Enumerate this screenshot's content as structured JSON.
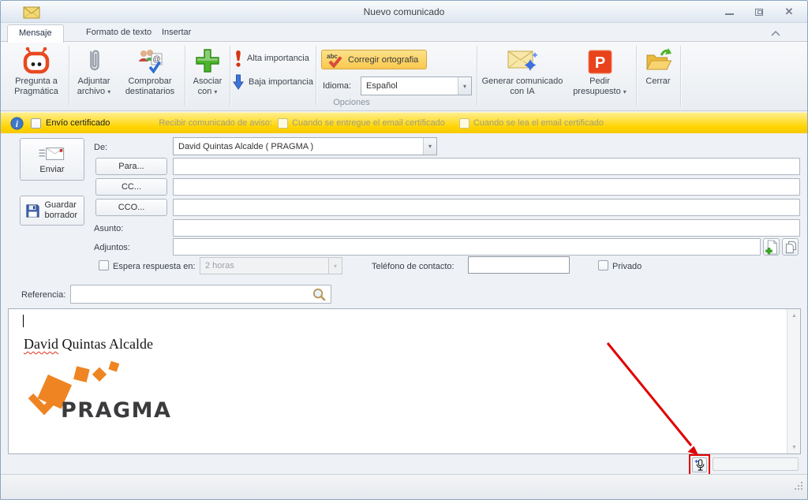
{
  "window": {
    "title": "Nuevo comunicado"
  },
  "glyphs": {
    "close": "✕",
    "dropdown": "▾",
    "scroll_up": "▲",
    "scroll_down": "▼"
  },
  "tabs": {
    "items": [
      {
        "label": "Mensaje",
        "active": true
      },
      {
        "label": "Formato de texto",
        "active": false
      },
      {
        "label": "Insertar",
        "active": false
      }
    ]
  },
  "ribbon": {
    "pregunta_label": "Pregunta a Pragmática",
    "adjuntar_label": "Adjuntar archivo",
    "comprobar_label": "Comprobar destinatarios",
    "asociar_label": "Asociar con",
    "alta_label": "Alta importancia",
    "baja_label": "Baja importancia",
    "corregir_label": "Corregir ortografia",
    "idioma_label": "Idioma:",
    "idioma_value": "Español",
    "group_opciones": "Opciones",
    "generar_label": "Generar comunicado con IA",
    "pedir_label": "Pedir presupuesto",
    "cerrar_label": "Cerrar"
  },
  "certbar": {
    "envio_label": "Envío certificado",
    "recibir_label": "Recibir comunicado de aviso:",
    "entregue_label": "Cuando se entregue el email certificado",
    "lea_label": "Cuando se lea el email certificado"
  },
  "form": {
    "enviar_label": "Enviar",
    "guardar_label": "Guardar borrador",
    "de_label": "De:",
    "de_value": "David Quintas Alcalde ( PRAGMA )",
    "para_label": "Para...",
    "para_value": "",
    "cc_label": "CC...",
    "cc_value": "",
    "cco_label": "CCO...",
    "cco_value": "",
    "asunto_label": "Asunto:",
    "asunto_value": "",
    "adjuntos_label": "Adjuntos:",
    "adjuntos_value": "",
    "espera_label": "Espera respuesta en:",
    "espera_value": "2 horas",
    "telefono_label": "Teléfono de contacto:",
    "telefono_value": "",
    "privado_label": "Privado",
    "referencia_label": "Referencia:",
    "referencia_value": ""
  },
  "body": {
    "signature_misspelled_word": "David",
    "signature_rest": " Quintas Alcalde",
    "logo_text": "PRAGMA"
  },
  "colors": {
    "cert_bar_yellow": "#ffd400",
    "spell_button_amber": "#f9c84e",
    "pragma_orange": "#ee8522",
    "annotation_red": "#e00000",
    "importance_high_red": "#d43310",
    "importance_low_blue": "#3f74d6"
  }
}
